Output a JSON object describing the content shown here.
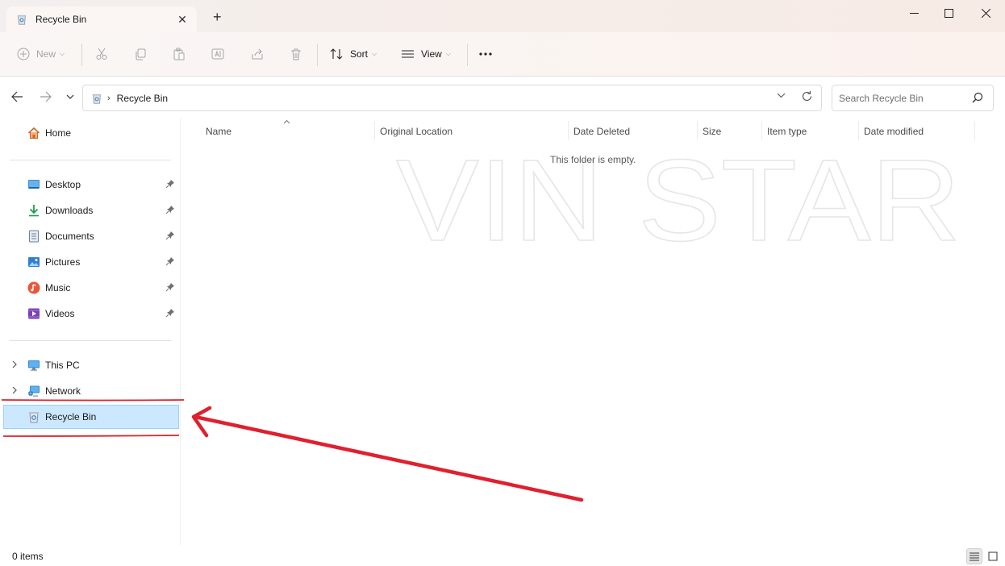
{
  "window": {
    "tab_title": "Recycle Bin",
    "tab_icon": "recycle-bin-icon",
    "controls": [
      "minimize-icon",
      "maximize-icon",
      "close-icon"
    ]
  },
  "toolbar": {
    "new_label": "New",
    "sort_label": "Sort",
    "view_label": "View",
    "icons": [
      "cut-icon",
      "copy-icon",
      "paste-icon",
      "rename-icon",
      "share-icon",
      "delete-icon",
      "more-icon"
    ]
  },
  "address": {
    "crumb": "Recycle Bin"
  },
  "search": {
    "placeholder": "Search Recycle Bin"
  },
  "sidebar": {
    "home": "Home",
    "quick_access": [
      {
        "label": "Desktop",
        "icon": "desktop-icon"
      },
      {
        "label": "Downloads",
        "icon": "downloads-icon"
      },
      {
        "label": "Documents",
        "icon": "documents-icon"
      },
      {
        "label": "Pictures",
        "icon": "pictures-icon"
      },
      {
        "label": "Music",
        "icon": "music-icon"
      },
      {
        "label": "Videos",
        "icon": "videos-icon"
      }
    ],
    "this_pc": "This PC",
    "network": "Network",
    "recycle_bin": "Recycle Bin"
  },
  "columns": {
    "name": "Name",
    "original_location": "Original Location",
    "date_deleted": "Date Deleted",
    "size": "Size",
    "item_type": "Item type",
    "date_modified": "Date modified"
  },
  "content": {
    "empty_message": "This folder is empty.",
    "watermark": "VIN STAR"
  },
  "status": {
    "item_count": "0 items"
  },
  "colors": {
    "selection_bg": "#cce8ff",
    "selection_border": "#99d1ff",
    "annotation_red": "#e0202e"
  }
}
